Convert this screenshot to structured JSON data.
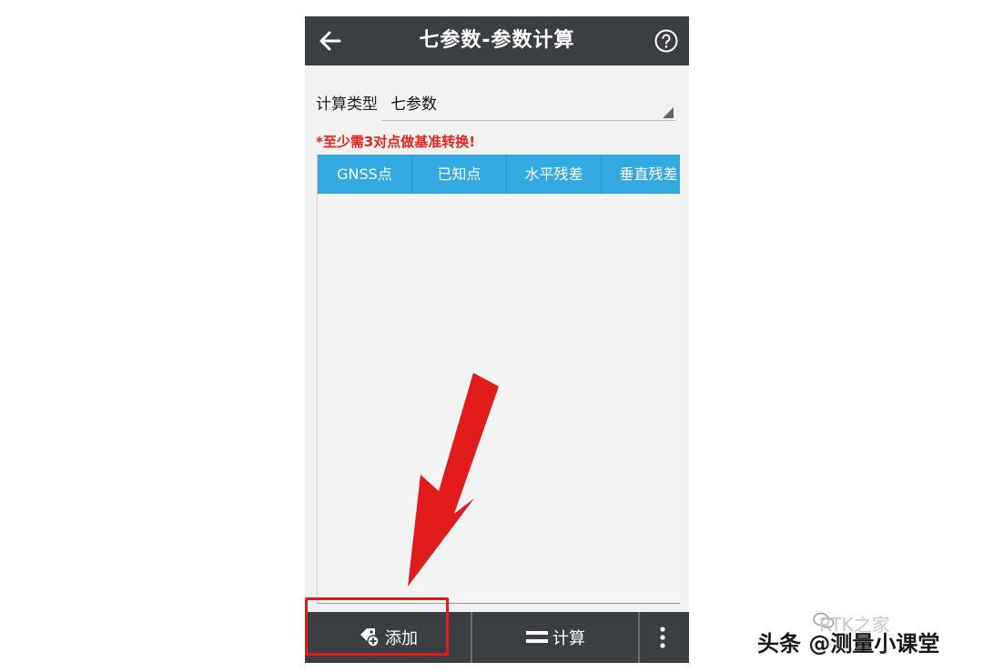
{
  "header": {
    "title": "七参数-参数计算",
    "back_icon": "back-arrow-icon",
    "help_icon": "help-icon"
  },
  "calc_type": {
    "label": "计算类型",
    "value": "七参数"
  },
  "warning": "*至少需3对点做基准转换!",
  "table": {
    "columns": [
      "GNSS点",
      "已知点",
      "水平残差",
      "垂直残差"
    ],
    "rows": []
  },
  "toolbar": {
    "add_label": "添加",
    "calc_label": "计算",
    "add_icon": "add-point-icon",
    "calc_icon": "equals-icon",
    "more_icon": "more-vertical-icon"
  },
  "annotation": {
    "color": "#e21b1b"
  },
  "watermark": {
    "text": "头条 @测量小课堂",
    "faint_text": "RTK之家"
  },
  "colors": {
    "header_bg": "#3b3f44",
    "table_header_bg": "#34a8e0",
    "warning": "#e8231c",
    "screen_bg": "#f2f2f2"
  }
}
